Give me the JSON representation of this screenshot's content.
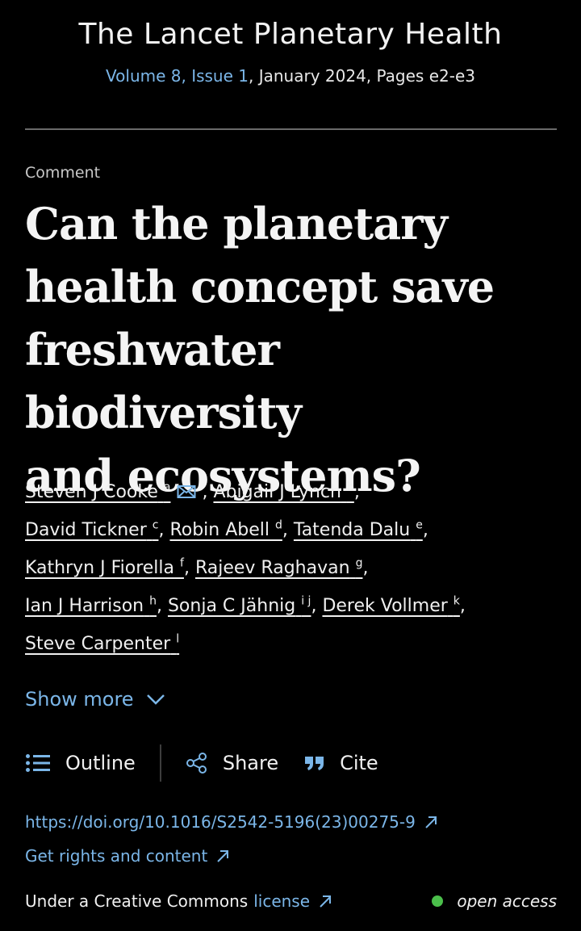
{
  "journal": {
    "title": "The Lancet Planetary Health",
    "issue_link": "Volume 8, Issue 1",
    "issue_rest": ", January 2024, Pages e2-e3"
  },
  "article": {
    "type": "Comment",
    "title_lines": [
      "Can the planetary",
      "health concept save",
      "freshwater biodiversity",
      "and ecosystems?"
    ]
  },
  "authors": [
    {
      "name": "Steven J Cooke",
      "aff": "a"
    },
    {
      "name": "Abigail J Lynch",
      "aff": "b"
    },
    {
      "name": "David Tickner",
      "aff": "c"
    },
    {
      "name": "Robin Abell",
      "aff": "d"
    },
    {
      "name": "Tatenda Dalu",
      "aff": "e"
    },
    {
      "name": "Kathryn J Fiorella",
      "aff": "f"
    },
    {
      "name": "Rajeev Raghavan",
      "aff": "g"
    },
    {
      "name": "Ian J Harrison",
      "aff": "h"
    },
    {
      "name": "Sonja C Jähnig",
      "aff": "i j"
    },
    {
      "name": "Derek Vollmer",
      "aff": "k"
    },
    {
      "name": "Steve Carpenter",
      "aff": "l"
    }
  ],
  "show_more": "Show more",
  "actions": {
    "outline": "Outline",
    "share": "Share",
    "cite": "Cite"
  },
  "links": {
    "doi": "https://doi.org/10.1016/S2542-5196(23)00275-9",
    "rights": "Get rights and content"
  },
  "license": {
    "prefix": "Under a Creative Commons",
    "link": "license",
    "open_access": "open access"
  },
  "colors": {
    "background": "#000000",
    "link": "#7bb6e8",
    "open_access_dot": "#4bbf4b"
  },
  "icons": {
    "email": "envelope-icon",
    "show_more": "chevron-down-icon",
    "outline": "list-icon",
    "share": "share-icon",
    "cite": "quote-icon",
    "external": "arrow-up-right-icon"
  }
}
